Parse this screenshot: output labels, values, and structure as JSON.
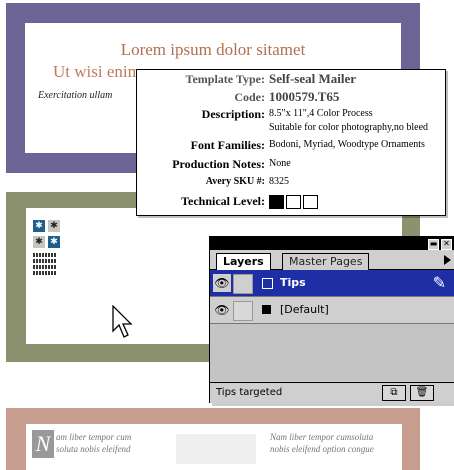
{
  "card1": {
    "title": "Lorem ipsum dolor sitamet",
    "subtitle": "Ut wisi enim a",
    "italic_text": "Exercitation ullam"
  },
  "card3": {
    "dropcap": "N",
    "text_left_1": "am liber tempor cum",
    "text_left_2": "soluta nobis eleifend",
    "text_right_1": "Nam liber tempor cumsoluta",
    "text_right_2": "nobis eleifend option congue"
  },
  "info": {
    "template_type_label": "Template Type:",
    "template_type_value": "Self-seal Mailer",
    "code_label": "Code:",
    "code_value": "1000579.T65",
    "description_label": "Description:",
    "description_line1": "8.5\"x 11\",4 Color Process",
    "description_line2": "Suitable for color photography,no bleed",
    "font_families_label": "Font Families:",
    "font_families_value": "Bodoni, Myriad, Woodtype Ornaments",
    "production_notes_label": "Production Notes:",
    "production_notes_value": "None",
    "sku_label": "Avery SKU #:",
    "sku_value": "8325",
    "technical_level_label": "Technical Level:",
    "technical_level": 1,
    "technical_level_max": 3
  },
  "palette": {
    "tabs": [
      "Layers",
      "Master Pages"
    ],
    "layers": [
      {
        "name": "Tips",
        "selected": true,
        "color": "#1e2fa5"
      },
      {
        "name": "[Default]",
        "selected": false,
        "color": "#000000"
      }
    ],
    "status": "Tips targeted",
    "icons": [
      "eye-icon",
      "pen-icon",
      "new-layer-icon",
      "trash-icon"
    ]
  },
  "colors": {
    "card1": "#6d6496",
    "card2": "#8c9270",
    "card3": "#c79d8f",
    "selection": "#1e2fa5"
  }
}
